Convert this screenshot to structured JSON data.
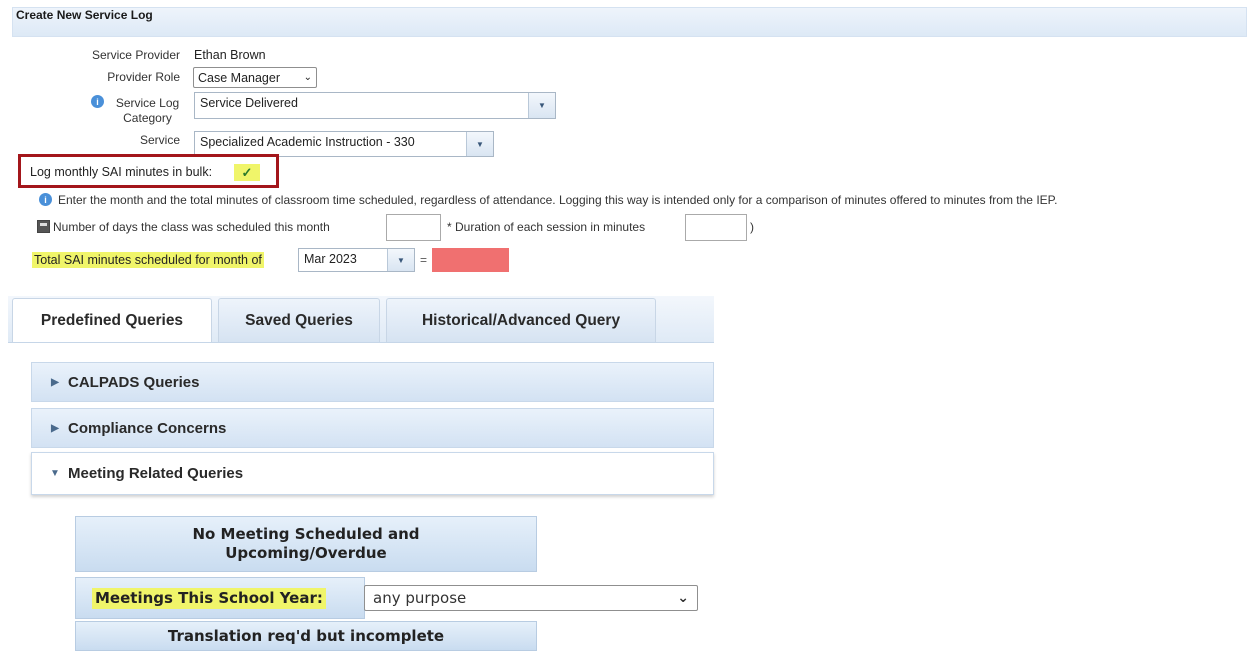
{
  "header": {
    "title": "Create New Service Log"
  },
  "form": {
    "service_provider_label": "Service Provider",
    "service_provider_value": "Ethan Brown",
    "provider_role_label": "Provider Role",
    "provider_role_value": "Case Manager",
    "category_label_line1": "Service Log",
    "category_label_line2": "Category",
    "category_value": "Service Delivered",
    "service_label": "Service",
    "service_value": "Specialized Academic Instruction - 330",
    "bulk_label": "Log monthly SAI minutes in bulk:",
    "bulk_checked": true,
    "info_text": "Enter the month and the total minutes of classroom time scheduled, regardless of attendance. Logging this way is intended only for a comparison of minutes offered to minutes from the IEP.",
    "days_label": "Number of days the class was scheduled this month",
    "days_value": "",
    "duration_label": "* Duration of each session in minutes",
    "duration_value": "",
    "close_paren": ")",
    "total_label": "Total SAI minutes scheduled for month of",
    "month_value": "Mar 2023",
    "equals": "=",
    "total_result_color": "#f07070"
  },
  "tabs": [
    {
      "label": "Predefined Queries",
      "active": true
    },
    {
      "label": "Saved Queries",
      "active": false
    },
    {
      "label": "Historical/Advanced Query",
      "active": false
    }
  ],
  "accordion": [
    {
      "label": "CALPADS Queries",
      "expanded": false
    },
    {
      "label": "Compliance Concerns",
      "expanded": false
    },
    {
      "label": "Meeting Related Queries",
      "expanded": true
    }
  ],
  "queries": {
    "no_meeting_line1": "No Meeting Scheduled and",
    "no_meeting_line2": "Upcoming/Overdue",
    "meetings_label": "Meetings This School Year:",
    "meetings_select_value": "any purpose",
    "translation_label": "Translation req'd but incomplete"
  },
  "colors": {
    "highlight": "#f0f56a",
    "red_box": "#a3161b",
    "accent_blue": "#4a90d9"
  },
  "icons": [
    "info-icon",
    "calculator-icon",
    "check-icon",
    "chevron-down-icon",
    "triangle-right-icon",
    "triangle-down-icon"
  ]
}
